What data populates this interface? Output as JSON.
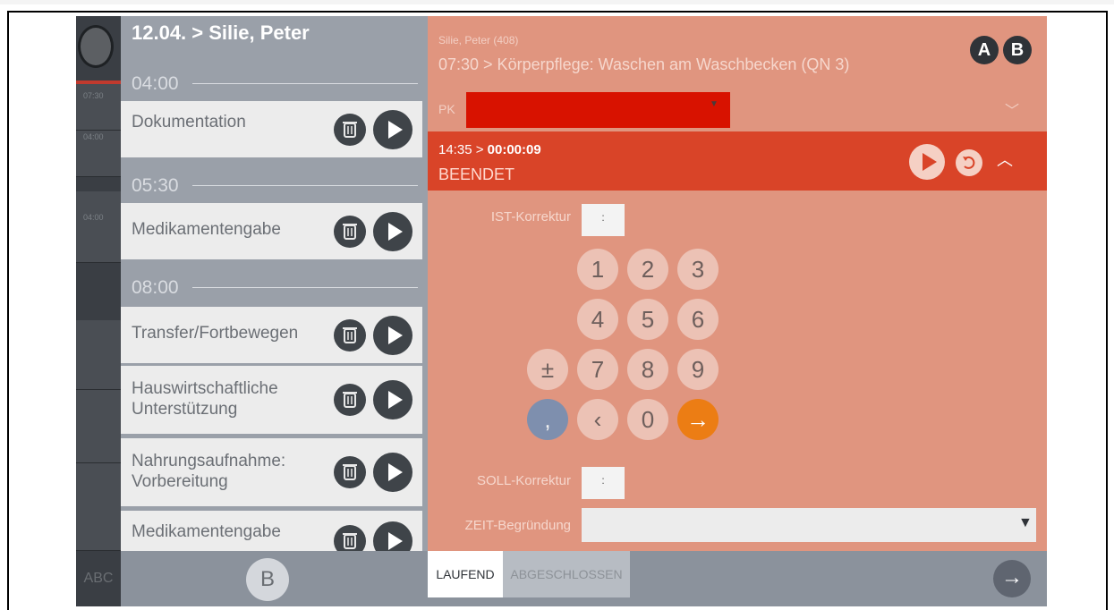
{
  "rail": {
    "time_labels": [
      "07:30",
      "04:00",
      "04:00"
    ],
    "abc_label": "ABC"
  },
  "schedule": {
    "header": "12.04. > Silie, Peter",
    "time_slots": [
      "04:00",
      "05:30",
      "08:00"
    ],
    "cards": [
      {
        "label": "Dokumentation"
      },
      {
        "label": "Medikamentengabe"
      },
      {
        "label": "Transfer/Fortbewegen"
      },
      {
        "label": "Hauswirtschaftliche\nUnterstützung"
      },
      {
        "label": "Nahrungsaufnahme:\nVorbereitung"
      },
      {
        "label": "Medikamentengabe"
      }
    ],
    "bottom_button": "B"
  },
  "detail": {
    "patient_name": "Silie, Peter (408)",
    "task_title": "07:30 > Körperpflege: Waschen am Waschbecken (QN 3)",
    "badge_a": "A",
    "badge_b": "B",
    "pk_label": "PK",
    "timer_prefix": "14:35 > ",
    "timer_value": "00:00:09",
    "status": "BEENDET",
    "ist_label": "IST-Korrektur",
    "ist_value": ":",
    "soll_label": "SOLL-Korrektur",
    "soll_value": ":",
    "zeit_label": "ZEIT-Begründung",
    "keypad": {
      "k1": "1",
      "k2": "2",
      "k3": "3",
      "k4": "4",
      "k5": "5",
      "k6": "6",
      "kpm": "±",
      "k7": "7",
      "k8": "8",
      "k9": "9",
      "kcomma": ",",
      "kback": "‹",
      "k0": "0",
      "kenter": "→"
    }
  },
  "tabs": {
    "running": "LAUFEND",
    "closed": "ABGESCHLOSSEN",
    "go_icon": "→"
  },
  "colors": {
    "panel": "#e0957f",
    "active_bar": "#d94428",
    "pk_select": "#d81200",
    "enter_key": "#ec7d14",
    "comma_key": "#7e8fae"
  }
}
